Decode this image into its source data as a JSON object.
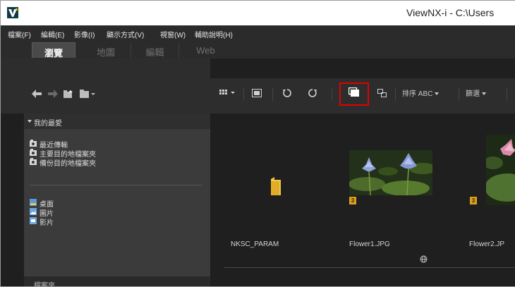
{
  "window": {
    "title": "ViewNX-i - C:\\Users"
  },
  "menu": {
    "items": [
      {
        "label": "檔案(F)"
      },
      {
        "label": "編輯(E)"
      },
      {
        "label": "影像(I)"
      },
      {
        "label": "顯示方式(V)"
      },
      {
        "label": "視窗(W)"
      },
      {
        "label": "輔助說明(H)"
      }
    ]
  },
  "tabs": [
    {
      "label": "瀏覽",
      "active": true
    },
    {
      "label": "地圖",
      "active": false
    },
    {
      "label": "編輯",
      "active": false
    },
    {
      "label": "Web",
      "active": false
    }
  ],
  "nav_toolbar": {
    "back_icon": "back-arrow-icon",
    "forward_icon": "forward-arrow-icon",
    "folder_up_icon": "folder-up-icon",
    "folder_menu_icon": "folder-menu-icon"
  },
  "favorites": {
    "title": "我的最愛",
    "items": [
      {
        "label": "最近傳輸"
      },
      {
        "label": "主要目的地檔案夾"
      },
      {
        "label": "備份目的地檔案夾"
      },
      {
        "label": "桌面"
      },
      {
        "label": "圖片"
      },
      {
        "label": "影片"
      }
    ]
  },
  "section2": {
    "title": "檔案夾"
  },
  "main_toolbar": {
    "sort_label": "排序 ABC",
    "filter_label": "篩選"
  },
  "files": [
    {
      "name": "NKSC_PARAM",
      "type": "folder"
    },
    {
      "name": "Flower1.JPG",
      "type": "image",
      "rating": "3"
    },
    {
      "name": "Flower2.JP",
      "type": "image",
      "rating": "3"
    }
  ],
  "colors": {
    "highlight": "#e00000",
    "rating_badge": "#d9a020",
    "menubar_bg": "#2b2b2b",
    "panel_bg": "#3b3b3b",
    "content_bg": "#1f1f1f"
  }
}
